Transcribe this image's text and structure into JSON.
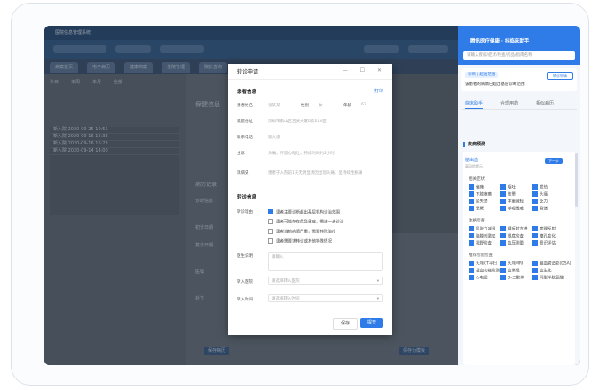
{
  "his": {
    "title": "医院信息管理系统",
    "tabs": [
      "病案首页",
      "电子病历",
      "健康档案",
      "住院管理",
      "院长查询"
    ],
    "menu_left": [
      "今日",
      "本周",
      "本月",
      "全部"
    ],
    "records": [
      {
        "name": "新入院",
        "date": "2020-09-25 10:55"
      },
      {
        "name": "新入院",
        "date": "2020-09-16 16:33"
      },
      {
        "name": "新入院",
        "date": "2020-09-16 16:23"
      },
      {
        "name": "新入院",
        "date": "2020-09-14 14:00"
      }
    ],
    "labels": [
      "保健信息",
      "病历记录",
      "诊断信息",
      "初诊日期",
      "复诊日期",
      "医嘱",
      "处方"
    ],
    "bottom_buttons": [
      "保存病历",
      "保存为模板"
    ]
  },
  "dialog": {
    "title": "转诊申请",
    "controls": "— ☐ ✕",
    "print_label": "打印",
    "patient_section": "患者信息",
    "fields": {
      "name_label": "患者姓名",
      "name_value": "张某某",
      "gender_label": "性别",
      "gender_value": "女",
      "age_label": "年龄",
      "age_value": "63",
      "address_label": "家庭住址",
      "address_value": "深圳市南山区百灵大厦B栋504室",
      "contact_label": "联系电话",
      "contact_value": "较大患",
      "complaint_label": "主诉",
      "complaint_value": "头痛，伴恶心呕吐，持续时间约2小时",
      "history_label": "现病史",
      "history_value": "患者于入院前1天无明显诱因出现头痛，呈持续性胀痛"
    },
    "referral_section": "转诊信息",
    "reason_label": "转诊理由",
    "reasons": [
      {
        "text": "患者主要诊断超出基层机构诊治范围",
        "checked": true
      },
      {
        "text": "患者可能存在危急重症，需进一步诊治",
        "checked": false
      },
      {
        "text": "患者当前病情严重，需要转院治疗",
        "checked": false
      },
      {
        "text": "患者需要求转诊或其他特殊情况",
        "checked": false
      }
    ],
    "note_label": "医生说明",
    "note_placeholder": "请输入",
    "dept_label": "转入医院",
    "dept_placeholder": "请选择转入医院",
    "time_label": "转入时间",
    "time_placeholder": "请选择转入时间",
    "save_label": "保存",
    "submit_label": "提交"
  },
  "panel": {
    "title": "腾讯医疗健康 · 抖临床助手",
    "search_placeholder": "请输入疾病/症状/检查/药品/指南名称",
    "tag": "诊断 | 超出范围",
    "switch_label": "转诊申请",
    "alert": "该患者的病情已超出基层诊断范围",
    "tabs": [
      "临床助手",
      "合理用药",
      "相似病历"
    ],
    "section": "疾病预测",
    "symptom_title": "脑出血",
    "symptom_sub": "高风险提示",
    "symptom_btn": "下一步",
    "groups": [
      {
        "label": "相关症状",
        "items": [
          "偏瘫",
          "呕吐",
          "发热",
          "下肢瘫痪",
          "眩晕",
          "头痛",
          "尿失禁",
          "体重减轻",
          "乏力",
          "晕厥",
          "呼吸困难",
          "昏迷"
        ]
      },
      {
        "label": "体格检查",
        "items": [
          "肌张力减退",
          "腱反射亢进",
          "病理反射",
          "脑膜刺激征",
          "眼底检查",
          "瞳孔变化",
          "视野检查",
          "血压测量",
          "意识评估"
        ]
      },
      {
        "label": "推荐检验检查",
        "items": [
          "头颅CT平扫",
          "头颅MRI",
          "脑血管造影(DSA)",
          "凝血功能检测",
          "血常规",
          "血生化",
          "心电图",
          "D-二聚体",
          "同型半胱氨酸"
        ]
      }
    ]
  }
}
